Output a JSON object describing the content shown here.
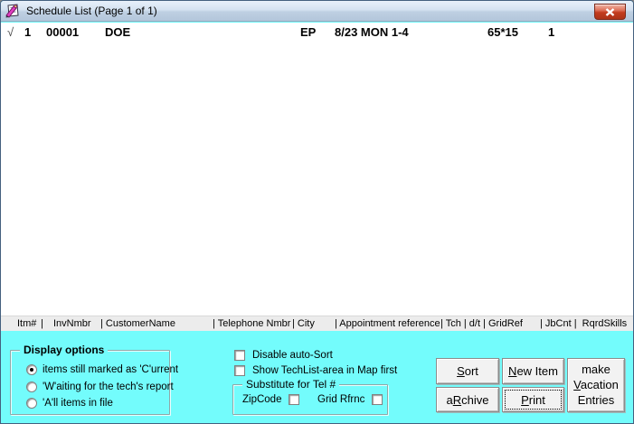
{
  "window": {
    "title": "Schedule List (Page 1 of 1)"
  },
  "row": {
    "checkmark": "√",
    "item_number": "1",
    "invoice_number": "00001",
    "customer_name": "DOE",
    "tech": "EP",
    "appointment": "8/23 MON 1-4",
    "grid_ref": "65*15",
    "job_count": "1"
  },
  "column_header": {
    "cols": [
      {
        "text": "Itm#"
      },
      {
        "text": "|"
      },
      {
        "text": "InvNmbr"
      },
      {
        "text": "| CustomerName"
      },
      {
        "text": "| Telephone Nmbr"
      },
      {
        "text": "| City"
      },
      {
        "text": "| Appointment reference"
      },
      {
        "text": "| Tch | d/t | GridRef"
      },
      {
        "text": "| JbCnt |  RqrdSkills"
      }
    ]
  },
  "display_options": {
    "title": "Display options",
    "options": [
      {
        "label": "items still marked as 'C'urrent",
        "selected": true
      },
      {
        "label": "'W'aiting for the tech's report",
        "selected": false
      },
      {
        "label": "'A'll items in file",
        "selected": false
      }
    ]
  },
  "sort_options": {
    "disable_auto_sort": {
      "label": "Disable auto-Sort",
      "checked": false
    },
    "show_techlist": {
      "label": "Show TechList-area in Map first",
      "checked": false
    }
  },
  "substitute": {
    "title": "Substitute for Tel #",
    "zipcode": {
      "label": "ZipCode",
      "checked": false
    },
    "grid_rfrnc": {
      "label": "Grid Rfrnc",
      "checked": false
    }
  },
  "buttons": {
    "sort": {
      "pre": "",
      "accel": "S",
      "post": "ort"
    },
    "new_item": {
      "pre": "",
      "accel": "N",
      "post": "ew Item"
    },
    "archive": {
      "pre": "a",
      "accel": "R",
      "post": "chive"
    },
    "print": {
      "pre": "",
      "accel": "P",
      "post": "rint"
    },
    "vacation": {
      "line1": "make",
      "accel": "V",
      "line2rest": "acation",
      "line3": "Entries"
    }
  },
  "colors": {
    "panel_cyan": "#73fcfc",
    "titlebar_blue": "#c6d6e8",
    "close_red": "#c23c1f",
    "header_gray": "#ececec"
  }
}
